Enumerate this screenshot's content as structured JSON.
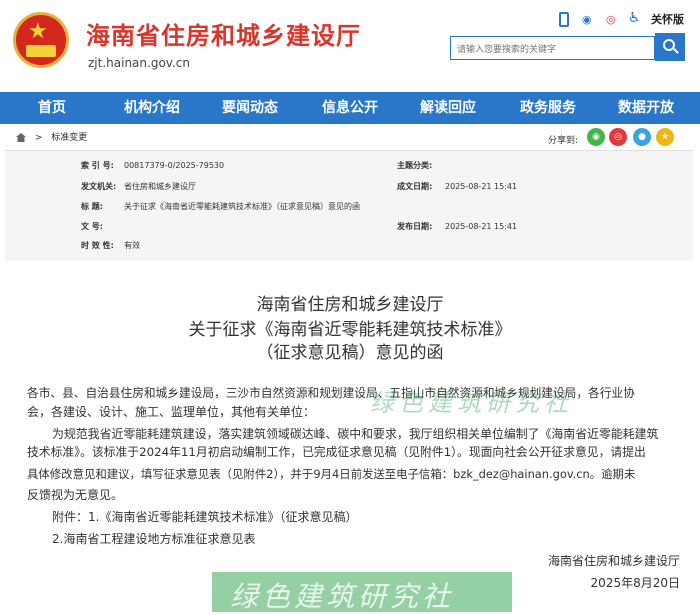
{
  "header": {
    "title": "海南省住房和城乡建设厅",
    "domain": "zjt.hainan.gov.cn",
    "care_label": "关怀版",
    "search_placeholder": "请输入您要搜索的关键字"
  },
  "nav": [
    "首页",
    "机构介绍",
    "要闻动态",
    "信息公开",
    "解读回应",
    "政务服务",
    "数据开放"
  ],
  "breadcrumb": {
    "current": "标准变更"
  },
  "share": {
    "label": "分享到:",
    "icons": [
      "wechat-share-icon",
      "weibo-share-icon",
      "qq-share-icon",
      "qzone-share-icon"
    ]
  },
  "meta": {
    "index_label": "索 引 号:",
    "index_value": "00817379-0/2025-79530",
    "category_label": "主题分类:",
    "category_value": "",
    "issuer_label": "发文机关:",
    "issuer_value": "省住房和城乡建设厅",
    "date_label": "成文日期:",
    "date_value": "2025-08-21 15:41",
    "title_label": "标    题:",
    "title_value": "关于征求《海南省近零能耗建筑技术标准》（征求意见稿）意见的函",
    "docno_label": "文    号:",
    "docno_value": "",
    "publish_label": "发布日期:",
    "publish_value": "2025-08-21 15:41",
    "validity_label": "时 效 性:",
    "validity_value": "有效"
  },
  "article": {
    "title_line1": "海南省住房和城乡建设厅",
    "title_line2": "关于征求《海南省近零能耗建筑技术标准》",
    "title_line3": "（征求意见稿）意见的函",
    "recipient_line1": "各市、县、自治县住房和城乡建设局，三沙市自然资源和规划建设局、五指山市自然资源和城乡规划建设局，各行业协",
    "recipient_line2": "会，各建设、设计、施工、监理单位，其他有关单位：",
    "para1_line1": "为规范我省近零能耗建筑建设，落实建筑领域碳达峰、碳中和要求，我厅组织相关单位编制了《海南省近零能耗建筑",
    "para1_line2": "技术标准》。该标准于2024年11月初启动编制工作，已完成征求意见稿（见附件1）。现面向社会公开征求意见，请提出",
    "para1_line3": "具体修改意见和建议，填写征求意见表（见附件2），并于9月4日前发送至电子信箱：bzk_dez@hainan.gov.cn。逾期未",
    "para1_line4": "反馈视为无意见。",
    "attachment1": "附件：1.《海南省近零能耗建筑技术标准》（征求意见稿）",
    "attachment2": "2.海南省工程建设地方标准征求意见表",
    "signature": "海南省住房和城乡建设厅",
    "sign_date": "2025年8月20日"
  },
  "watermark": "绿色建筑研究社"
}
